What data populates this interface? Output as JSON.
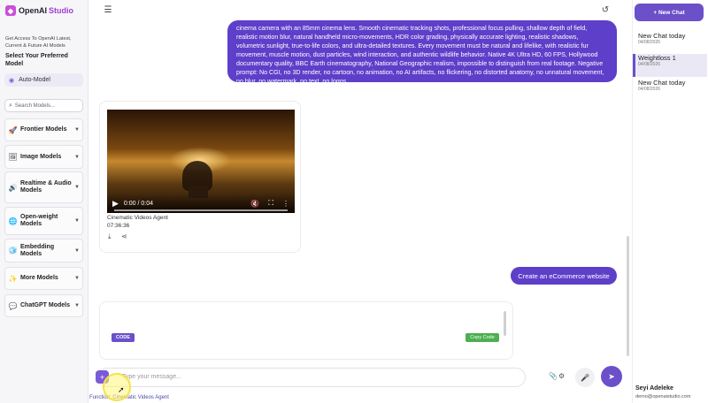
{
  "app": {
    "logo_text": "OpenAI",
    "logo_accent": "Studio"
  },
  "sidebar": {
    "promo": "Get Access To OpenAI Latest, Current & Future AI Models",
    "prefer_heading": "Select Your Preferred Model",
    "auto_model": "Auto-Model",
    "search_placeholder": "Search Models...",
    "categories": [
      {
        "label": "Frontier Models",
        "icon": "rocket-icon"
      },
      {
        "label": "Image Models",
        "icon": "image-icon"
      },
      {
        "label": "Realtime & Audio Models",
        "icon": "speaker-icon"
      },
      {
        "label": "Open-weight Models",
        "icon": "globe-icon"
      },
      {
        "label": "Embedding Models",
        "icon": "cube-icon"
      },
      {
        "label": "More Models",
        "icon": "sparkle-icon"
      },
      {
        "label": "ChatGPT Models",
        "icon": "chat-icon"
      }
    ]
  },
  "chat": {
    "prompt_text": "cinema camera with an 85mm cinema lens. Smooth cinematic tracking shots, professional focus pulling, shallow depth of field, realistic motion blur, natural handheld micro-movements, HDR color grading, physically accurate lighting, realistic shadows, volumetric sunlight, true-to-life colors, and ultra-detailed textures. Every movement must be natural and lifelike, with realistic fur movement, muscle motion, dust particles, wind interaction, and authentic wildlife behavior. Native 4K Ultra HD, 60 FPS, Hollywood documentary quality, BBC Earth cinematography, National Geographic realism, impossible to distinguish from real footage. Negative prompt: No CGI, no 3D render, no cartoon, no animation, no AI artifacts, no flickering, no distorted anatomy, no unnatural movement, no blur, no watermark, no text, no logos.",
    "video": {
      "time_display": "0:00 / 0:04",
      "agent_name": "Cinematic Videos Agent",
      "timestamp": "07:36:36"
    },
    "user_message": "Create an eCommerce website",
    "code_badge": "CODE",
    "copy_label": "Copy Code"
  },
  "input": {
    "placeholder": "Type your message...",
    "function_label": "Function: Cinematic Videos Agent"
  },
  "right_panel": {
    "new_chat_label": "+ New Chat",
    "chats": [
      {
        "title": "New Chat today",
        "date": "04/08/2026",
        "active": false
      },
      {
        "title": "Weightloss 1",
        "date": "04/08/2026",
        "active": true
      },
      {
        "title": "New Chat today",
        "date": "04/08/2026",
        "active": false
      }
    ],
    "user_name": "Seyi Adeleke",
    "user_email": "demo@openaistudio.com"
  },
  "colors": {
    "accent": "#6b50c9",
    "copy_button": "#4caf50",
    "logo": "#c94fd8"
  }
}
